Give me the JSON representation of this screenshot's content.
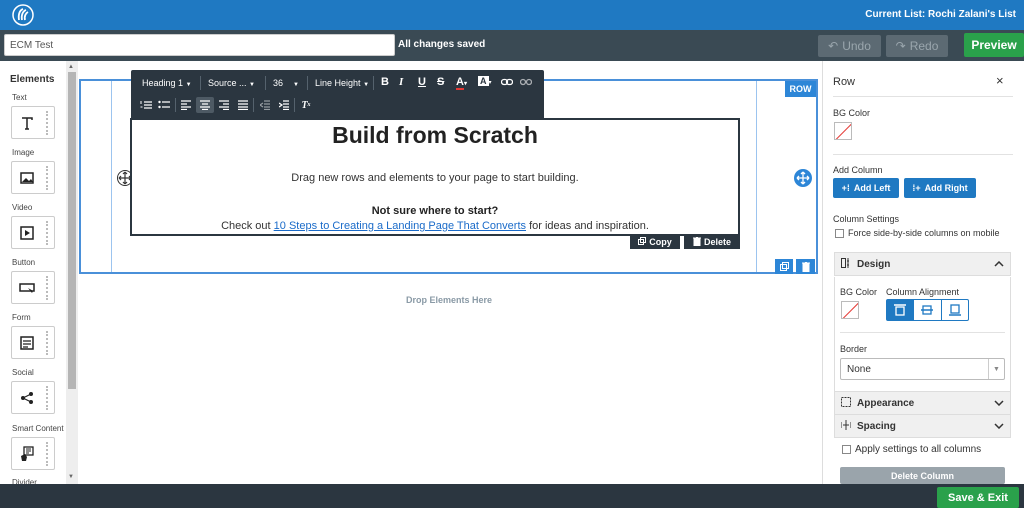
{
  "header": {
    "current_list": "Current List: Rochi Zalani's List"
  },
  "subheader": {
    "doc_name": "ECM Test",
    "status": "All changes saved",
    "undo": "Undo",
    "redo": "Redo",
    "preview": "Preview"
  },
  "elements": {
    "title": "Elements",
    "items": [
      {
        "label": "Text",
        "icon": "text-icon"
      },
      {
        "label": "Image",
        "icon": "image-icon"
      },
      {
        "label": "Video",
        "icon": "video-icon"
      },
      {
        "label": "Button",
        "icon": "button-icon"
      },
      {
        "label": "Form",
        "icon": "form-icon"
      },
      {
        "label": "Social",
        "icon": "share-icon"
      },
      {
        "label": "Smart Content",
        "icon": "smart-content-icon"
      },
      {
        "label": "Divider",
        "icon": "divider-icon"
      }
    ]
  },
  "toolbar": {
    "heading": "Heading 1",
    "font": "Source ...",
    "size": "36",
    "line_height": "Line Height"
  },
  "content": {
    "heading": "Build from Scratch",
    "intro": "Drag new rows and elements to your page to start building.",
    "question": "Not sure where to start?",
    "check_prefix": "Check out ",
    "link": "10 Steps to Creating a Landing Page That Converts",
    "check_suffix": " for ideas and inspiration.",
    "copy": "Copy",
    "delete": "Delete",
    "row_badge": "ROW",
    "drop": "Drop Elements Here"
  },
  "panel": {
    "title": "Row",
    "bg_color": "BG Color",
    "add_column": "Add Column",
    "add_left": "Add Left",
    "add_right": "Add Right",
    "column_settings": "Column Settings",
    "force_mobile": "Force side-by-side columns on mobile",
    "design": "Design",
    "design_bg": "BG Color",
    "column_alignment": "Column Alignment",
    "border": "Border",
    "border_value": "None",
    "appearance": "Appearance",
    "spacing": "Spacing",
    "apply_all": "Apply settings to all columns",
    "delete_column": "Delete Column"
  },
  "footer": {
    "save_exit": "Save & Exit"
  },
  "colors": {
    "brand_blue": "#1f79c2",
    "green": "#2aa14b",
    "dark": "#2b3640"
  }
}
